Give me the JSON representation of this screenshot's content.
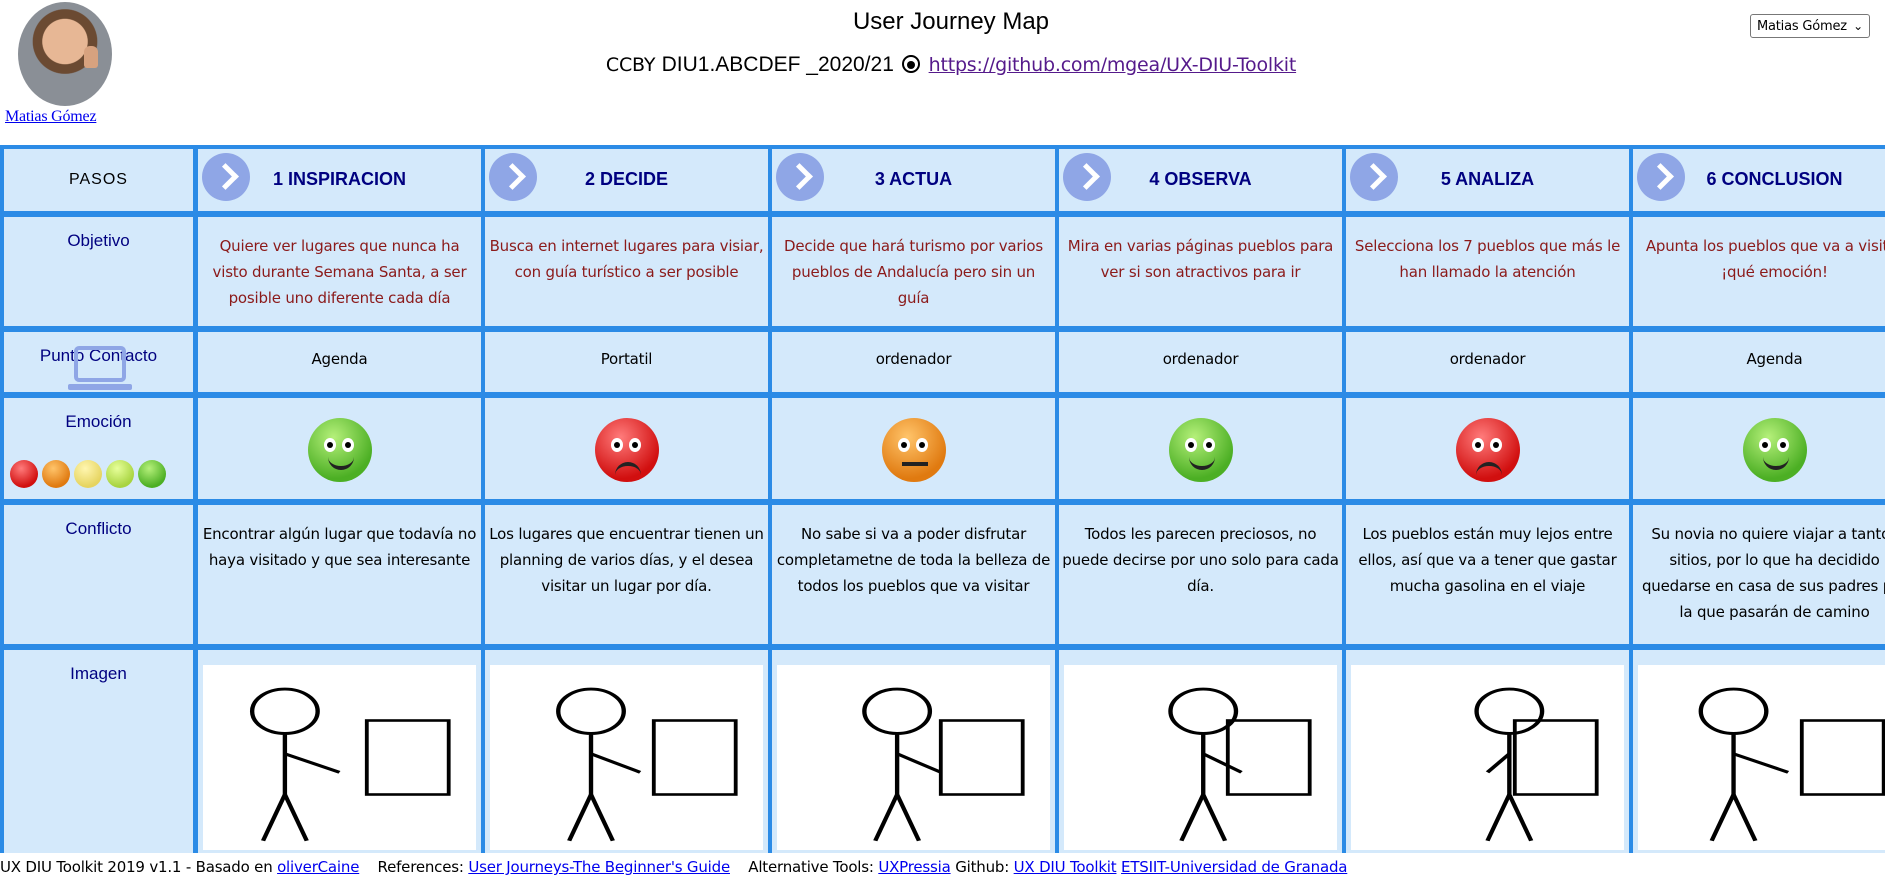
{
  "header": {
    "title": "User Journey Map",
    "license": "CCBY",
    "course_code": "DIU1.ABCDEF _2020/21",
    "repo_link": "https://github.com/mgea/UX-DIU-Toolkit",
    "user_name": "Matias Gómez",
    "user_select_value": "Matias Gómez"
  },
  "row_labels": {
    "steps": "PASOS",
    "objective": "Objetivo",
    "contact": "Punto Contacto",
    "emotion": "Emoción",
    "conflict": "Conflicto",
    "image": "Imagen"
  },
  "steps": [
    {
      "title": "1 INSPIRACION",
      "objective": "Quiere ver lugares que nunca ha visto durante Semana Santa, a ser posible uno diferente cada día",
      "contact": "Agenda",
      "emotion": "happy",
      "conflict": "Encontrar algún lugar que todavía no haya visitado y que sea interesante"
    },
    {
      "title": "2 DECIDE",
      "objective": "Busca en internet lugares para visiar, con guía turístico a ser posible",
      "contact": "Portatil",
      "emotion": "angry",
      "conflict": "Los lugares que encuentrar tienen un planning de varios días, y el desea visitar un lugar por día."
    },
    {
      "title": "3 ACTUA",
      "objective": "Decide que hará turismo por varios pueblos de Andalucía pero sin un guía",
      "contact": "ordenador",
      "emotion": "meh",
      "conflict": "No sabe si va a poder disfrutar completametne de toda la belleza de todos los pueblos que va visitar"
    },
    {
      "title": "4 OBSERVA",
      "objective": "Mira en varias páginas pueblos para ver si son atractivos para ir",
      "contact": "ordenador",
      "emotion": "happy",
      "conflict": "Todos les parecen preciosos, no puede decirse por uno solo para cada día."
    },
    {
      "title": "5 ANALIZA",
      "objective": "Selecciona los 7 pueblos que más le han llamado la atención",
      "contact": "ordenador",
      "emotion": "angry",
      "conflict": "Los pueblos están muy lejos entre ellos, así que va a tener que gastar mucha gasolina en el viaje"
    },
    {
      "title": "6 CONCLUSION",
      "objective": "Apunta los pueblos que va a visitar ¡qué emoción!",
      "contact": "Agenda",
      "emotion": "happy",
      "conflict": "Su novia no quiere viajar a tantos sitios, por lo que ha decidido quedarse en casa de sus padres por la que pasarán de camino"
    }
  ],
  "footer": {
    "prefix": "UX DIU Toolkit 2019 v1.1 - Basado en",
    "based_on": "oliverCaine",
    "references_label": "References:",
    "references_link": "User Journeys-The Beginner's Guide",
    "alt_tools_label": "Alternative Tools:",
    "alt_tools_link": "UXPressia",
    "github_label": "Github:",
    "github_link": "UX DIU Toolkit",
    "school_link": "ETSIIT-Universidad de Granada"
  },
  "colors": {
    "grid_border": "#2b8be6",
    "cell_bg": "#d4e9fb",
    "label_text": "#000080",
    "objective_text": "#8b1a1a"
  }
}
